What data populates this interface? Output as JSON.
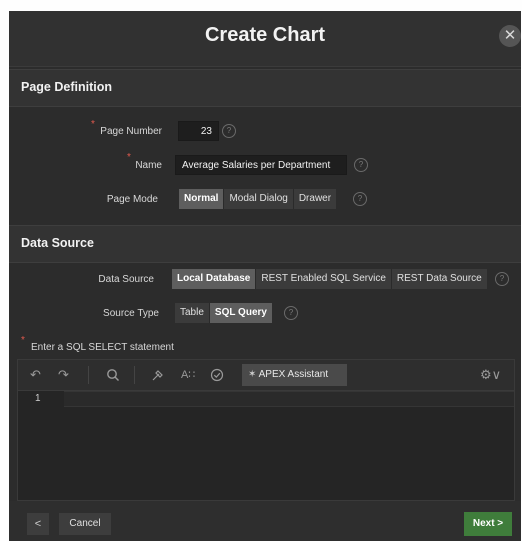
{
  "dialog": {
    "title": "Create Chart",
    "close_glyph": "✕"
  },
  "page_definition": {
    "heading": "Page Definition",
    "page_number_label": "Page Number",
    "page_number_value": "23",
    "name_label": "Name",
    "name_value": "Average Salaries per Department",
    "page_mode_label": "Page Mode",
    "page_mode_options": [
      "Normal",
      "Modal Dialog",
      "Drawer"
    ],
    "page_mode_selected": "Normal"
  },
  "data_source": {
    "heading": "Data Source",
    "data_source_label": "Data Source",
    "data_source_options": [
      "Local Database",
      "REST Enabled SQL Service",
      "REST Data Source"
    ],
    "data_source_selected": "Local Database",
    "source_type_label": "Source Type",
    "source_type_options": [
      "Table",
      "SQL Query"
    ],
    "source_type_selected": "SQL Query",
    "sql_prompt": "Enter a SQL SELECT statement"
  },
  "editor": {
    "apex_assistant_label": "APEX Assistant",
    "line_number": "1"
  },
  "footer": {
    "previous_glyph": "<",
    "cancel_label": "Cancel",
    "next_label": "Next >"
  },
  "common": {
    "required_marker": "*",
    "help_glyph": "?"
  },
  "colors": {
    "dialog_background": "#2c2c2c",
    "next_button": "#3f7d3b",
    "selected_segment": "#5e5e5e",
    "required_marker": "#e05a4e"
  }
}
